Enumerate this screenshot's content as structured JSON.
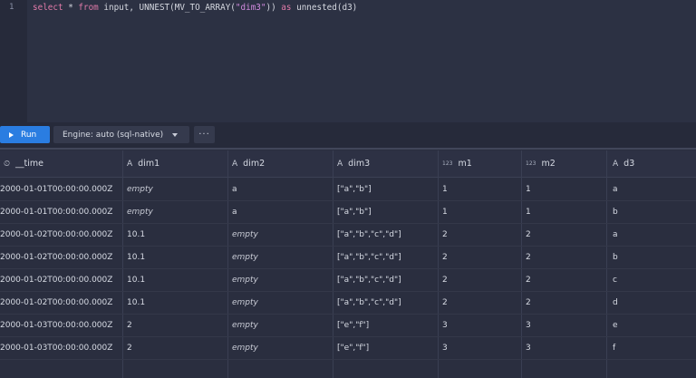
{
  "editor": {
    "line_number": "1",
    "kw_select": "select",
    "star": " * ",
    "kw_from": "from",
    "mid": " input, UNNEST(MV_TO_ARRAY(",
    "str_dim3": "\"dim3\"",
    "close": ")) ",
    "kw_as": "as",
    "tail": " unnested(d3)"
  },
  "toolbar": {
    "run_label": "Run",
    "engine_label": "Engine: auto (sql-native)",
    "more_label": "···"
  },
  "columns": [
    {
      "icon": "clock-icon",
      "glyph": "⏲",
      "name": "__time"
    },
    {
      "icon": "string-type-icon",
      "glyph": "A",
      "name": "dim1"
    },
    {
      "icon": "string-type-icon",
      "glyph": "A",
      "name": "dim2"
    },
    {
      "icon": "string-type-icon",
      "glyph": "A",
      "name": "dim3"
    },
    {
      "icon": "number-type-icon",
      "glyph": "123",
      "name": "m1"
    },
    {
      "icon": "number-type-icon",
      "glyph": "123",
      "name": "m2"
    },
    {
      "icon": "string-type-icon",
      "glyph": "A",
      "name": "d3"
    }
  ],
  "rows": [
    [
      "2000-01-01T00:00:00.000Z",
      "empty",
      "a",
      "[\"a\",\"b\"]",
      "1",
      "1",
      "a"
    ],
    [
      "2000-01-01T00:00:00.000Z",
      "empty",
      "a",
      "[\"a\",\"b\"]",
      "1",
      "1",
      "b"
    ],
    [
      "2000-01-02T00:00:00.000Z",
      "10.1",
      "empty",
      "[\"a\",\"b\",\"c\",\"d\"]",
      "2",
      "2",
      "a"
    ],
    [
      "2000-01-02T00:00:00.000Z",
      "10.1",
      "empty",
      "[\"a\",\"b\",\"c\",\"d\"]",
      "2",
      "2",
      "b"
    ],
    [
      "2000-01-02T00:00:00.000Z",
      "10.1",
      "empty",
      "[\"a\",\"b\",\"c\",\"d\"]",
      "2",
      "2",
      "c"
    ],
    [
      "2000-01-02T00:00:00.000Z",
      "10.1",
      "empty",
      "[\"a\",\"b\",\"c\",\"d\"]",
      "2",
      "2",
      "d"
    ],
    [
      "2000-01-03T00:00:00.000Z",
      "2",
      "empty",
      "[\"e\",\"f\"]",
      "3",
      "3",
      "e"
    ],
    [
      "2000-01-03T00:00:00.000Z",
      "2",
      "empty",
      "[\"e\",\"f\"]",
      "3",
      "3",
      "f"
    ]
  ],
  "colors": {
    "accent": "#2a7de1",
    "background": "#2a2e3f"
  }
}
